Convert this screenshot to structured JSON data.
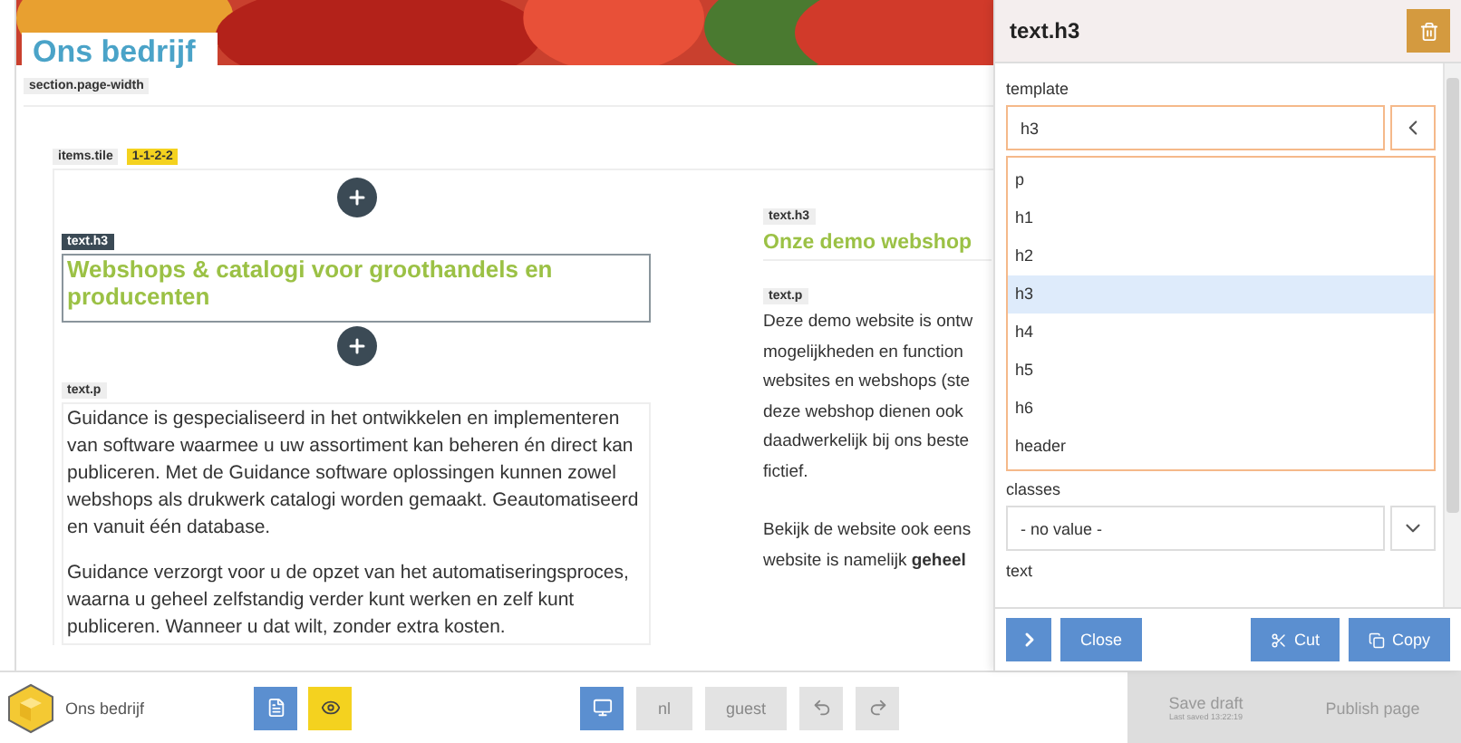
{
  "page": {
    "title": "Ons bedrijf",
    "section_tag": "section.page-width",
    "tile_tag": "items.tile",
    "tile_badge": "1-1-2-2",
    "left": {
      "heading_tag": "text.h3",
      "heading": "Webshops & catalogi voor groothandels en producenten",
      "heading_selected": true,
      "para_tag": "text.p",
      "paragraphs": [
        "Guidance is gespecialiseerd in het ontwikkelen en implementeren van software waarmee u uw assortiment kan beheren én direct kan publiceren. Met de Guidance software oplossingen kunnen zowel webshops als drukwerk catalogi worden gemaakt. Geautomatiseerd en vanuit één database.",
        "Guidance verzorgt voor u de opzet van het automatiseringsproces, waarna u geheel zelfstandig verder kunt werken en zelf kunt publiceren. Wanneer u dat wilt, zonder extra kosten."
      ]
    },
    "right": {
      "heading_tag": "text.h3",
      "heading": "Onze demo webshop",
      "para_tag": "text.p",
      "paragraphs": [
        [
          "Deze demo website is ontw",
          "mogelijkheden en function",
          "websites en webshops (ste",
          "deze webshop dienen ook",
          "daadwerkelijk bij ons beste",
          "fictief."
        ],
        [
          "Bekijk de website ook eens",
          "website is namelijk **geheel**"
        ]
      ]
    }
  },
  "panel": {
    "title": "text.h3",
    "template_label": "template",
    "template_value": "h3",
    "options": [
      {
        "label": "p",
        "selected": false
      },
      {
        "label": "h1",
        "selected": false
      },
      {
        "label": "h2",
        "selected": false
      },
      {
        "label": "h3",
        "selected": true
      },
      {
        "label": "h4",
        "selected": false
      },
      {
        "label": "h5",
        "selected": false
      },
      {
        "label": "h6",
        "selected": false
      },
      {
        "label": "header",
        "selected": false
      }
    ],
    "classes_label": "classes",
    "classes_value": "- no value -",
    "text_label": "text",
    "buttons": [
      "Close",
      "Cut",
      "Copy"
    ]
  },
  "bottom_bar": {
    "site": "Ons bedrijf",
    "language": "nl",
    "user": "guest",
    "save": "Save draft",
    "last_saved": "Last saved 13:22:19",
    "publish": "Publish page"
  }
}
